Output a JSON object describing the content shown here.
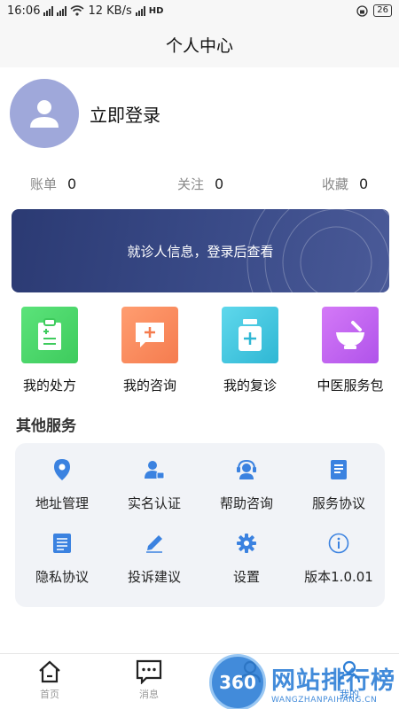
{
  "status_bar": {
    "time": "16:06",
    "network_speed": "12 KB/s",
    "network_type_1": "4G",
    "network_type_2": "5G",
    "hd_label": "HD",
    "battery": "26"
  },
  "header": {
    "title": "个人中心"
  },
  "profile": {
    "login_text": "立即登录"
  },
  "stats": [
    {
      "label": "账单",
      "value": "0"
    },
    {
      "label": "关注",
      "value": "0"
    },
    {
      "label": "收藏",
      "value": "0"
    }
  ],
  "info_card": {
    "text": "就诊人信息，登录后查看"
  },
  "quick_actions": [
    {
      "label": "我的处方",
      "icon": "prescription-icon",
      "color": "#4cd964"
    },
    {
      "label": "我的咨询",
      "icon": "consultation-icon",
      "color": "#ff8a5c"
    },
    {
      "label": "我的复诊",
      "icon": "revisit-icon",
      "color": "#37c6e0"
    },
    {
      "label": "中医服务包",
      "icon": "tcm-package-icon",
      "color": "#c061f0"
    }
  ],
  "other_services": {
    "title": "其他服务",
    "items": [
      {
        "label": "地址管理",
        "icon": "location-pin-icon"
      },
      {
        "label": "实名认证",
        "icon": "id-verify-icon"
      },
      {
        "label": "帮助咨询",
        "icon": "headset-icon"
      },
      {
        "label": "服务协议",
        "icon": "document-icon"
      },
      {
        "label": "隐私协议",
        "icon": "privacy-doc-icon"
      },
      {
        "label": "投诉建议",
        "icon": "pencil-icon"
      },
      {
        "label": "设置",
        "icon": "gear-icon"
      },
      {
        "label": "版本1.0.01",
        "icon": "info-icon"
      }
    ]
  },
  "tabbar": [
    {
      "label": "首页",
      "icon": "home-icon"
    },
    {
      "label": "消息",
      "icon": "message-icon"
    },
    {
      "label": "",
      "icon": "doctor-icon"
    },
    {
      "label": "我的",
      "icon": "profile-icon"
    }
  ],
  "watermark": {
    "badge": "360",
    "main": "网站排行榜",
    "sub": "WANGZHANPAIHANG.CN"
  },
  "colors": {
    "accent_icon": "#3b82e0",
    "card_bg": "#2f3f7c",
    "avatar_bg": "#9fa8da"
  }
}
